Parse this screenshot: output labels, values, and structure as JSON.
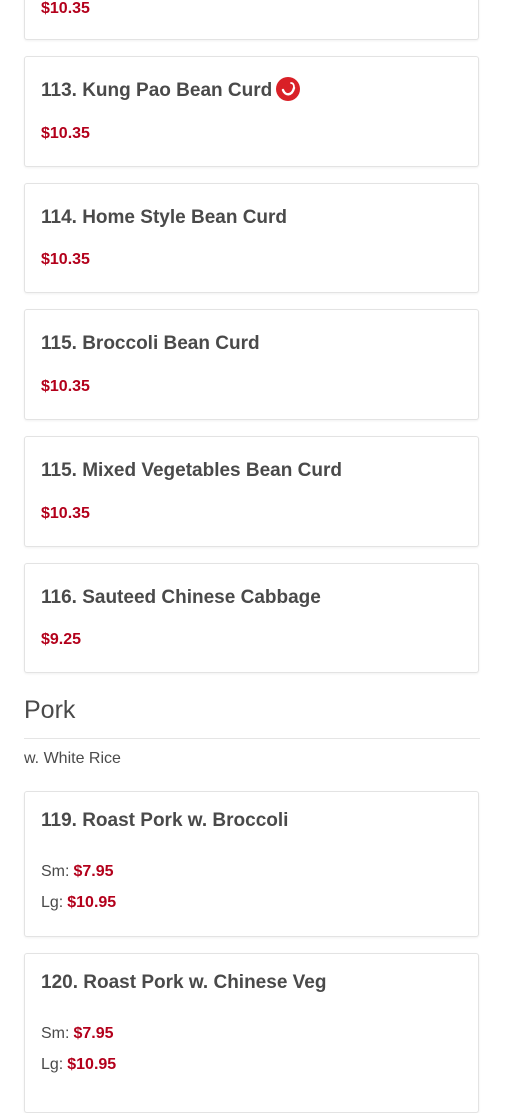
{
  "top_partial": {
    "price": "$10.35"
  },
  "items": [
    {
      "name": "113. Kung Pao Bean Curd",
      "price": "$10.35",
      "spicy": true
    },
    {
      "name": "114. Home Style Bean Curd",
      "price": "$10.35"
    },
    {
      "name": "115. Broccoli Bean Curd",
      "price": "$10.35"
    },
    {
      "name": "115. Mixed Vegetables Bean Curd",
      "price": "$10.35"
    },
    {
      "name": "116. Sauteed Chinese Cabbage",
      "price": "$9.25"
    }
  ],
  "section": {
    "title": "Pork",
    "description": "w. White Rice"
  },
  "pork_items": [
    {
      "name": "119. Roast Pork w. Broccoli",
      "sm_label": "Sm:",
      "sm_price": "$7.95",
      "lg_label": "Lg:",
      "lg_price": "$10.95"
    },
    {
      "name": "120. Roast Pork w. Chinese Veg",
      "sm_label": "Sm:",
      "sm_price": "$7.95",
      "lg_label": "Lg:",
      "lg_price": "$10.95"
    }
  ],
  "colors": {
    "price": "#b3001b",
    "spicy_badge": "#d92027"
  },
  "icons": {
    "spicy": "chili-pepper-icon"
  }
}
